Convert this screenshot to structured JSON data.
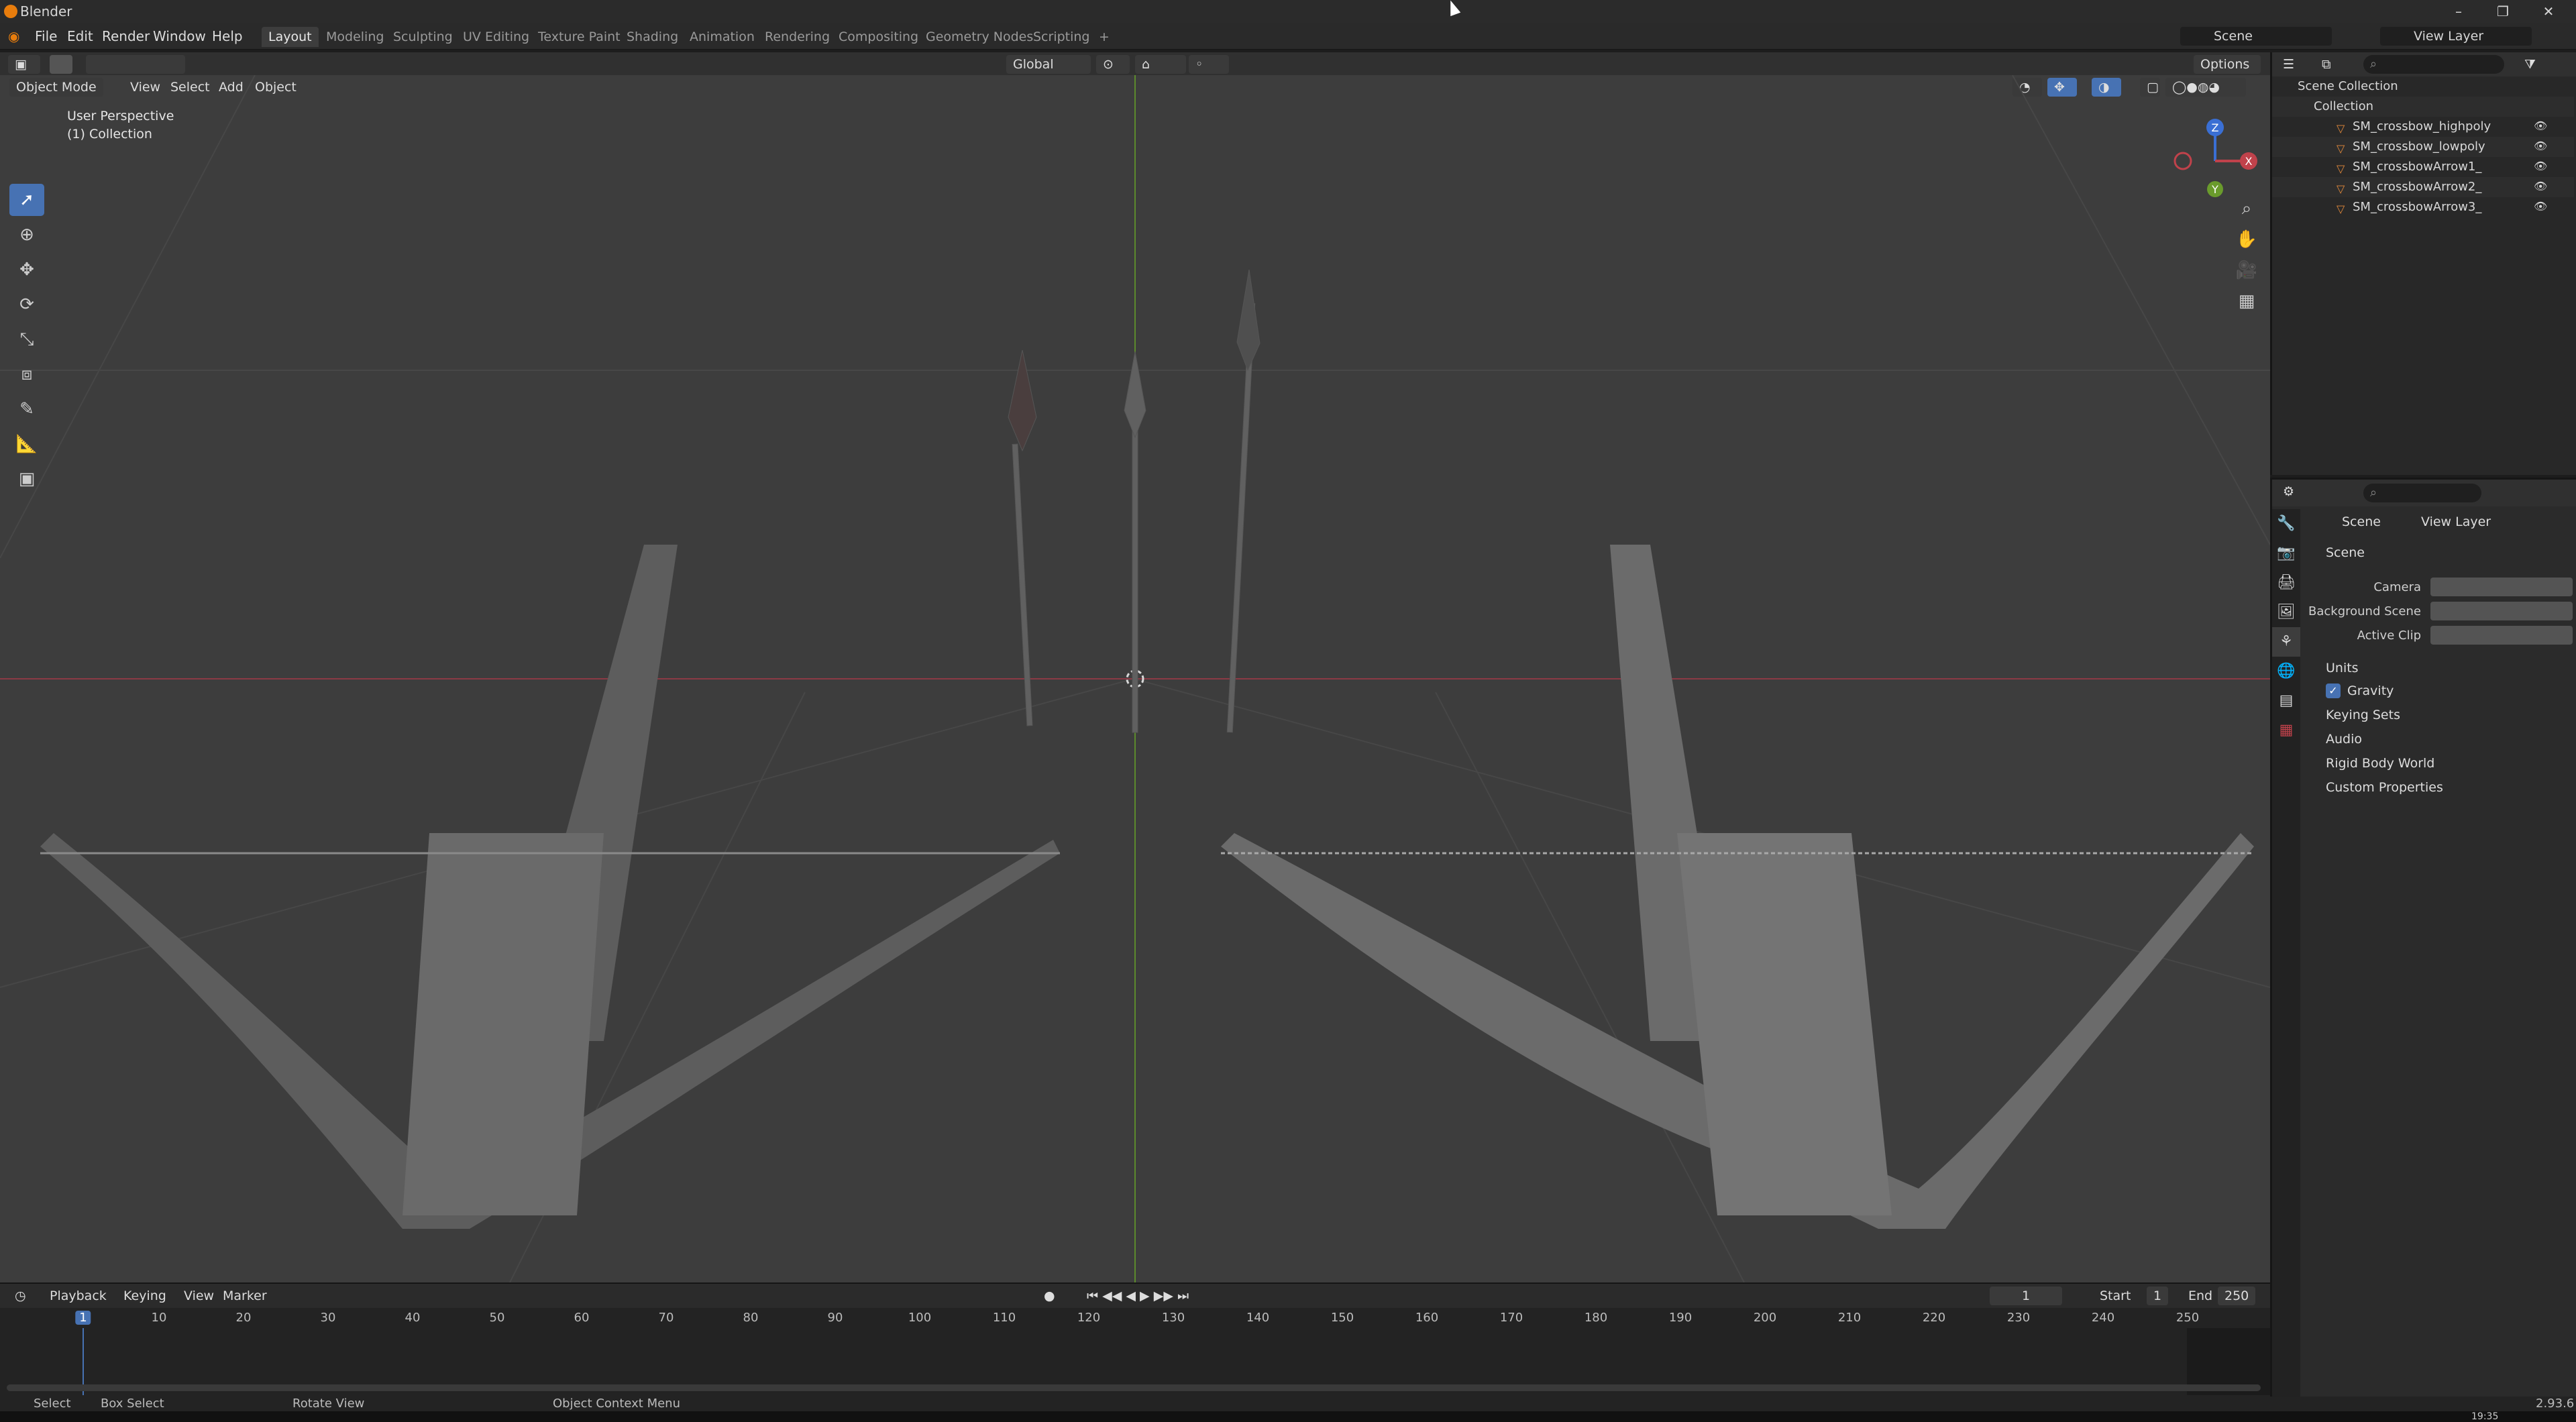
{
  "window": {
    "title": "Blender"
  },
  "menu": {
    "items": [
      "File",
      "Edit",
      "Render",
      "Window",
      "Help"
    ]
  },
  "workspaces": {
    "tabs": [
      "Layout",
      "Modeling",
      "Sculpting",
      "UV Editing",
      "Texture Paint",
      "Shading",
      "Animation",
      "Rendering",
      "Compositing",
      "Geometry Nodes",
      "Scripting"
    ],
    "active": "Layout",
    "add": "+"
  },
  "topright": {
    "scene": "Scene",
    "view_layer": "View Layer"
  },
  "viewport_header": {
    "mode": "Object Mode",
    "menus": [
      "View",
      "Select",
      "Add",
      "Object"
    ],
    "orientation": "Global",
    "options": "Options"
  },
  "viewport": {
    "overlay_line1": "User Perspective",
    "overlay_line2": "(1) Collection",
    "gizmo": {
      "z": "Z",
      "x": "X",
      "y": "Y"
    }
  },
  "outliner": {
    "root": "Scene Collection",
    "collection": "Collection",
    "objects": [
      "SM_crossbow_highpoly",
      "SM_crossbow_lowpoly",
      "SM_crossbowArrow1_",
      "SM_crossbowArrow2_",
      "SM_crossbowArrow3_"
    ]
  },
  "properties": {
    "breadcrumb_scene": "Scene",
    "breadcrumb_layer": "View Layer",
    "section": "Scene",
    "camera_label": "Camera",
    "bgscene_label": "Background Scene",
    "activeclip_label": "Active Clip",
    "subsections": [
      "Units",
      "Gravity",
      "Keying Sets",
      "Audio",
      "Rigid Body World",
      "Custom Properties"
    ],
    "gravity_checked": true
  },
  "timeline": {
    "menus": [
      "Playback",
      "Keying",
      "View",
      "Marker"
    ],
    "current_frame": "1",
    "start_label": "Start",
    "start": "1",
    "end_label": "End",
    "end": "250",
    "ticks": [
      "1",
      "10",
      "20",
      "30",
      "40",
      "50",
      "60",
      "70",
      "80",
      "90",
      "100",
      "110",
      "120",
      "130",
      "140",
      "150",
      "160",
      "170",
      "180",
      "190",
      "200",
      "210",
      "220",
      "230",
      "240",
      "250"
    ]
  },
  "statusbar": {
    "select": "Select",
    "box_select": "Box Select",
    "rotate_view": "Rotate View",
    "context_menu": "Object Context Menu",
    "version": "2.93.6"
  },
  "taskbar": {
    "clock": "19:35"
  },
  "colors": {
    "accent": "#4772b3",
    "x_axis": "#c0424b",
    "y_axis": "#6a9b2c",
    "z_axis": "#3a6fd4",
    "object_icon": "#e3893a",
    "mesh_icon": "#22b27c"
  }
}
